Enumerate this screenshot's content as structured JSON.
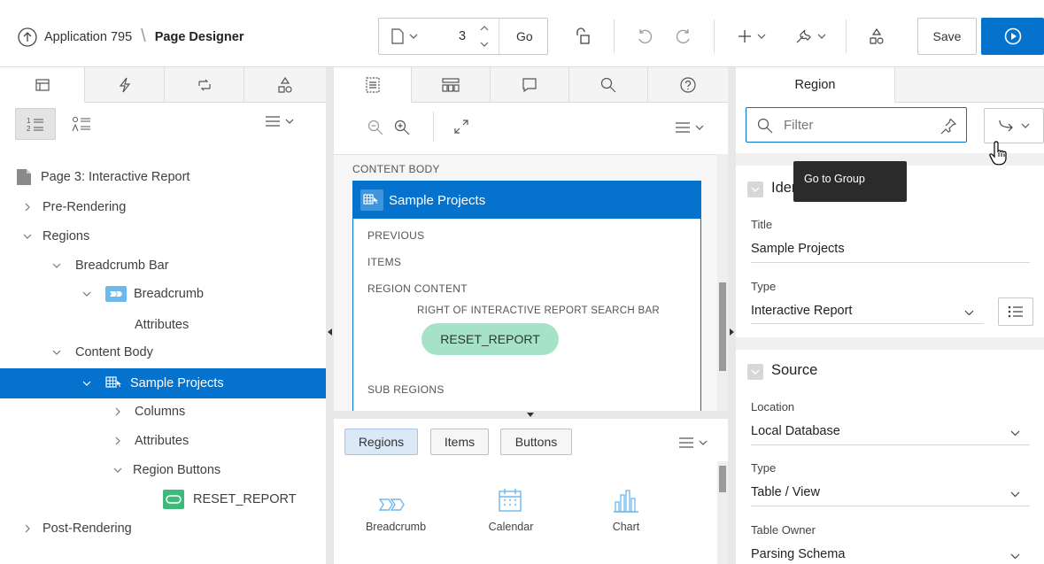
{
  "header": {
    "app_label": "Application 795",
    "separator": "\\",
    "title": "Page Designer",
    "page_number": "3",
    "go_label": "Go",
    "save_label": "Save"
  },
  "left": {
    "tree": {
      "page": "Page 3: Interactive Report",
      "pre_rendering": "Pre-Rendering",
      "regions": "Regions",
      "breadcrumb_bar": "Breadcrumb Bar",
      "breadcrumb": "Breadcrumb",
      "attributes1": "Attributes",
      "content_body": "Content Body",
      "sample_projects": "Sample Projects",
      "columns": "Columns",
      "attributes2": "Attributes",
      "region_buttons": "Region Buttons",
      "reset_report": "RESET_REPORT",
      "post_rendering": "Post-Rendering"
    }
  },
  "middle": {
    "content_body": "CONTENT BODY",
    "region_title": "Sample Projects",
    "previous": "PREVIOUS",
    "items": "ITEMS",
    "region_content": "REGION CONTENT",
    "right_of_search": "RIGHT OF INTERACTIVE REPORT SEARCH BAR",
    "reset_button": "RESET_REPORT",
    "sub_regions": "SUB REGIONS",
    "gallery_tabs": [
      "Regions",
      "Items",
      "Buttons"
    ],
    "gallery_items": [
      "Breadcrumb",
      "Calendar",
      "Chart"
    ]
  },
  "right": {
    "tab": "Region",
    "filter_placeholder": "Filter",
    "tooltip": "Go to Group",
    "identification": "Identification",
    "title_label": "Title",
    "title_value": "Sample Projects",
    "type_label": "Type",
    "type_value": "Interactive Report",
    "source": "Source",
    "location_label": "Location",
    "location_value": "Local Database",
    "type2_label": "Type",
    "type2_value": "Table / View",
    "owner_label": "Table Owner",
    "owner_value": "Parsing Schema"
  },
  "colors": {
    "accent": "#0572ce",
    "button_green": "#a6e3c6",
    "icon_blue": "#6db8ec"
  }
}
